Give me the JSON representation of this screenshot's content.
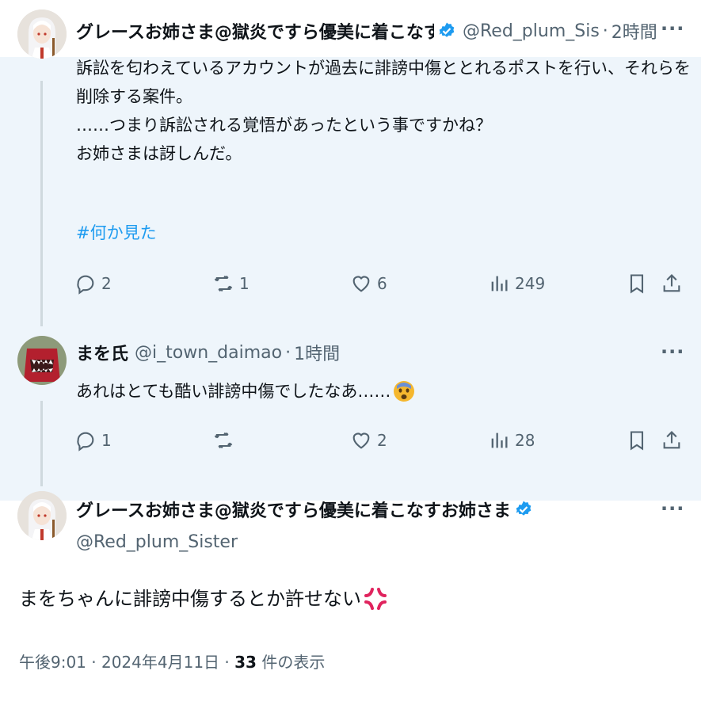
{
  "tweets": [
    {
      "author_name": "グレースお姉さま@獄炎ですら優美に着こなすお姉さま",
      "handle": "@Red_plum_Sis",
      "separator": "·",
      "time": "2時間",
      "text_lines": [
        "訴訟を匂わえているアカウントが過去に誹謗中傷ととれるポストを行い、それらを",
        "削除する案件。",
        "……つまり訴訟される覚悟があったという事ですかね？",
        "お姉さまは訝しんだ。"
      ],
      "hashtag": "#何か見た",
      "replies": "2",
      "reposts": "1",
      "likes": "6",
      "views": "249"
    },
    {
      "author_name": "まを氏",
      "handle": "@i_town_daimao",
      "separator": "·",
      "time": "1時間",
      "text": "あれはとても酷い誹謗中傷でしたなあ……",
      "emoji": "fearful-face",
      "replies": "1",
      "reposts": "",
      "likes": "2",
      "views": "28"
    }
  ],
  "main_tweet": {
    "author_name": "グレースお姉さま@獄炎ですら優美に着こなすお姉さま",
    "handle": "@Red_plum_Sister",
    "text": "まをちゃんに誹謗中傷するとか許せない",
    "emoji": "anger-symbol",
    "timestamp": "午後9:01 · 2024年4月11日 · ",
    "view_count": "33",
    "view_label": "件の表示"
  },
  "more_icon": "···",
  "colors": {
    "accent": "#1d9bf0",
    "muted": "#536471",
    "thread_bg": "#eef5fb"
  }
}
